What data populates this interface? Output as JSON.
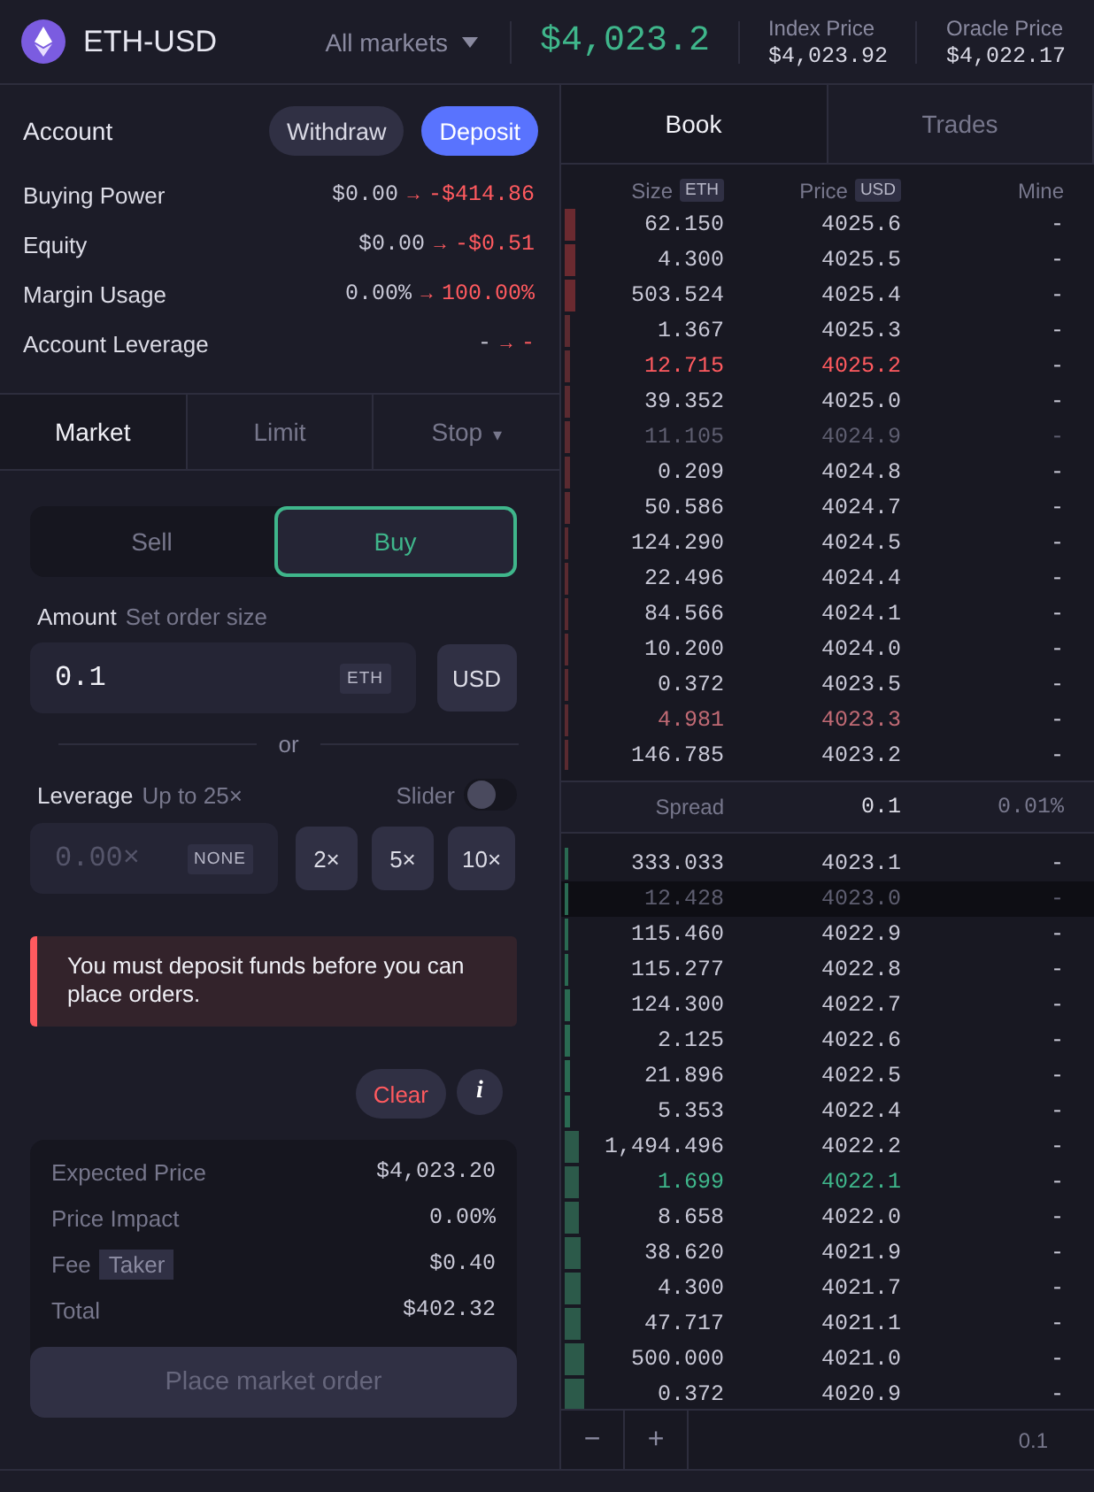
{
  "header": {
    "market": "ETH-USD",
    "markets_dropdown": "All markets",
    "last_price": "$4,023.2",
    "stats": [
      {
        "label": "Index Price",
        "value": "$4,023.92"
      },
      {
        "label": "Oracle Price",
        "value": "$4,022.17"
      }
    ]
  },
  "account": {
    "title": "Account",
    "buttons": [
      {
        "label": "Withdraw",
        "kind": "secondary"
      },
      {
        "label": "Deposit",
        "kind": "primary"
      }
    ],
    "rows": [
      {
        "label": "Buying Power",
        "from": "$0.00",
        "arrow": "→",
        "to": "-$414.86"
      },
      {
        "label": "Equity",
        "from": "$0.00",
        "arrow": "→",
        "to": "-$0.51"
      },
      {
        "label": "Margin Usage",
        "from": "0.00%",
        "arrow": "→",
        "to": "100.00%"
      },
      {
        "label": "Account Leverage",
        "from": "-",
        "arrow": "→",
        "to": "-"
      }
    ]
  },
  "order_tabs": [
    {
      "label": "Market",
      "selected": true
    },
    {
      "label": "Limit",
      "selected": false
    },
    {
      "label": "Stop",
      "selected": false,
      "caret": "▾"
    }
  ],
  "sides": [
    {
      "label": "Sell",
      "selected": false
    },
    {
      "label": "Buy",
      "selected": true
    }
  ],
  "amount": {
    "label": "Amount",
    "hint": "Set order size",
    "value": "0.1",
    "unit": "ETH",
    "toggle": "USD"
  },
  "or": "or",
  "leverage": {
    "label": "Leverage",
    "hint": "Up to 25×",
    "slider_label": "Slider",
    "slider_on": false,
    "placeholder": "0.00×",
    "none": "NONE",
    "presets": [
      "2×",
      "5×",
      "10×"
    ]
  },
  "alert": "You must deposit funds before you can place orders.",
  "clear": "Clear",
  "info": "i",
  "summary": [
    {
      "label": "Expected Price",
      "value": "$4,023.20"
    },
    {
      "label": "Price Impact",
      "value": "0.00%"
    },
    {
      "label": "Fee",
      "tag": "Taker",
      "value": "$0.40"
    },
    {
      "label": "Total",
      "value": "$402.32"
    }
  ],
  "place_order": {
    "label": "Place market order",
    "disabled": true
  },
  "book_tabs": [
    {
      "label": "Book",
      "selected": true
    },
    {
      "label": "Trades",
      "selected": false
    }
  ],
  "book_columns": [
    {
      "label": "Size",
      "unit": "ETH"
    },
    {
      "label": "Price",
      "unit": "USD"
    },
    {
      "label": "Mine"
    }
  ],
  "asks": [
    {
      "size": "62.150",
      "price": "4025.6",
      "mine": "-",
      "kind": "normal",
      "level": 0.02
    },
    {
      "size": "4.300",
      "price": "4025.5",
      "mine": "-",
      "kind": "normal",
      "level": 0.02
    },
    {
      "size": "503.524",
      "price": "4025.4",
      "mine": "-",
      "kind": "normal",
      "level": 0.02
    },
    {
      "size": "1.367",
      "price": "4025.3",
      "mine": "-",
      "kind": "normal",
      "level": 0.01
    },
    {
      "size": "12.715",
      "price": "4025.2",
      "mine": "-",
      "kind": "flash",
      "level": 0.01
    },
    {
      "size": "39.352",
      "price": "4025.0",
      "mine": "-",
      "kind": "normal",
      "level": 0.01
    },
    {
      "size": "11.105",
      "price": "4024.9",
      "mine": "-",
      "kind": "dim",
      "level": 0.01
    },
    {
      "size": "0.209",
      "price": "4024.8",
      "mine": "-",
      "kind": "normal",
      "level": 0.01
    },
    {
      "size": "50.586",
      "price": "4024.7",
      "mine": "-",
      "kind": "normal",
      "level": 0.01
    },
    {
      "size": "124.290",
      "price": "4024.5",
      "mine": "-",
      "kind": "normal",
      "level": 0.005
    },
    {
      "size": "22.496",
      "price": "4024.4",
      "mine": "-",
      "kind": "normal",
      "level": 0.005
    },
    {
      "size": "84.566",
      "price": "4024.1",
      "mine": "-",
      "kind": "normal",
      "level": 0.005
    },
    {
      "size": "10.200",
      "price": "4024.0",
      "mine": "-",
      "kind": "normal",
      "level": 0.005
    },
    {
      "size": "0.372",
      "price": "4023.5",
      "mine": "-",
      "kind": "normal",
      "level": 0.005
    },
    {
      "size": "4.981",
      "price": "4023.3",
      "mine": "-",
      "kind": "fading",
      "level": 0.005
    },
    {
      "size": "146.785",
      "price": "4023.2",
      "mine": "-",
      "kind": "normal",
      "level": 0.005
    }
  ],
  "spread": {
    "label": "Spread",
    "value": "0.1",
    "percent": "0.01%"
  },
  "bids": [
    {
      "size": "333.033",
      "price": "4023.1",
      "mine": "-",
      "kind": "normal",
      "level": 0.005,
      "hovered": false
    },
    {
      "size": "12.428",
      "price": "4023.0",
      "mine": "-",
      "kind": "dim",
      "level": 0.005,
      "hovered": true
    },
    {
      "size": "115.460",
      "price": "4022.9",
      "mine": "-",
      "kind": "normal",
      "level": 0.007,
      "hovered": false
    },
    {
      "size": "115.277",
      "price": "4022.8",
      "mine": "-",
      "kind": "normal",
      "level": 0.007,
      "hovered": false
    },
    {
      "size": "124.300",
      "price": "4022.7",
      "mine": "-",
      "kind": "normal",
      "level": 0.01,
      "hovered": false
    },
    {
      "size": "2.125",
      "price": "4022.6",
      "mine": "-",
      "kind": "normal",
      "level": 0.01,
      "hovered": false
    },
    {
      "size": "21.896",
      "price": "4022.5",
      "mine": "-",
      "kind": "normal",
      "level": 0.01,
      "hovered": false
    },
    {
      "size": "5.353",
      "price": "4022.4",
      "mine": "-",
      "kind": "normal",
      "level": 0.01,
      "hovered": false
    },
    {
      "size": "1,494.496",
      "price": "4022.2",
      "mine": "-",
      "kind": "normal",
      "level": 0.027,
      "hovered": false
    },
    {
      "size": "1.699",
      "price": "4022.1",
      "mine": "-",
      "kind": "flash",
      "level": 0.027,
      "hovered": false
    },
    {
      "size": "8.658",
      "price": "4022.0",
      "mine": "-",
      "kind": "normal",
      "level": 0.027,
      "hovered": false
    },
    {
      "size": "38.620",
      "price": "4021.9",
      "mine": "-",
      "kind": "normal",
      "level": 0.03,
      "hovered": false
    },
    {
      "size": "4.300",
      "price": "4021.7",
      "mine": "-",
      "kind": "normal",
      "level": 0.03,
      "hovered": false
    },
    {
      "size": "47.717",
      "price": "4021.1",
      "mine": "-",
      "kind": "normal",
      "level": 0.03,
      "hovered": false
    },
    {
      "size": "500.000",
      "price": "4021.0",
      "mine": "-",
      "kind": "normal",
      "level": 0.037,
      "hovered": false
    },
    {
      "size": "0.372",
      "price": "4020.9",
      "mine": "-",
      "kind": "normal",
      "level": 0.037,
      "hovered": false
    }
  ],
  "book_footer": {
    "minus": "−",
    "plus": "+",
    "grouping": "0.1"
  }
}
